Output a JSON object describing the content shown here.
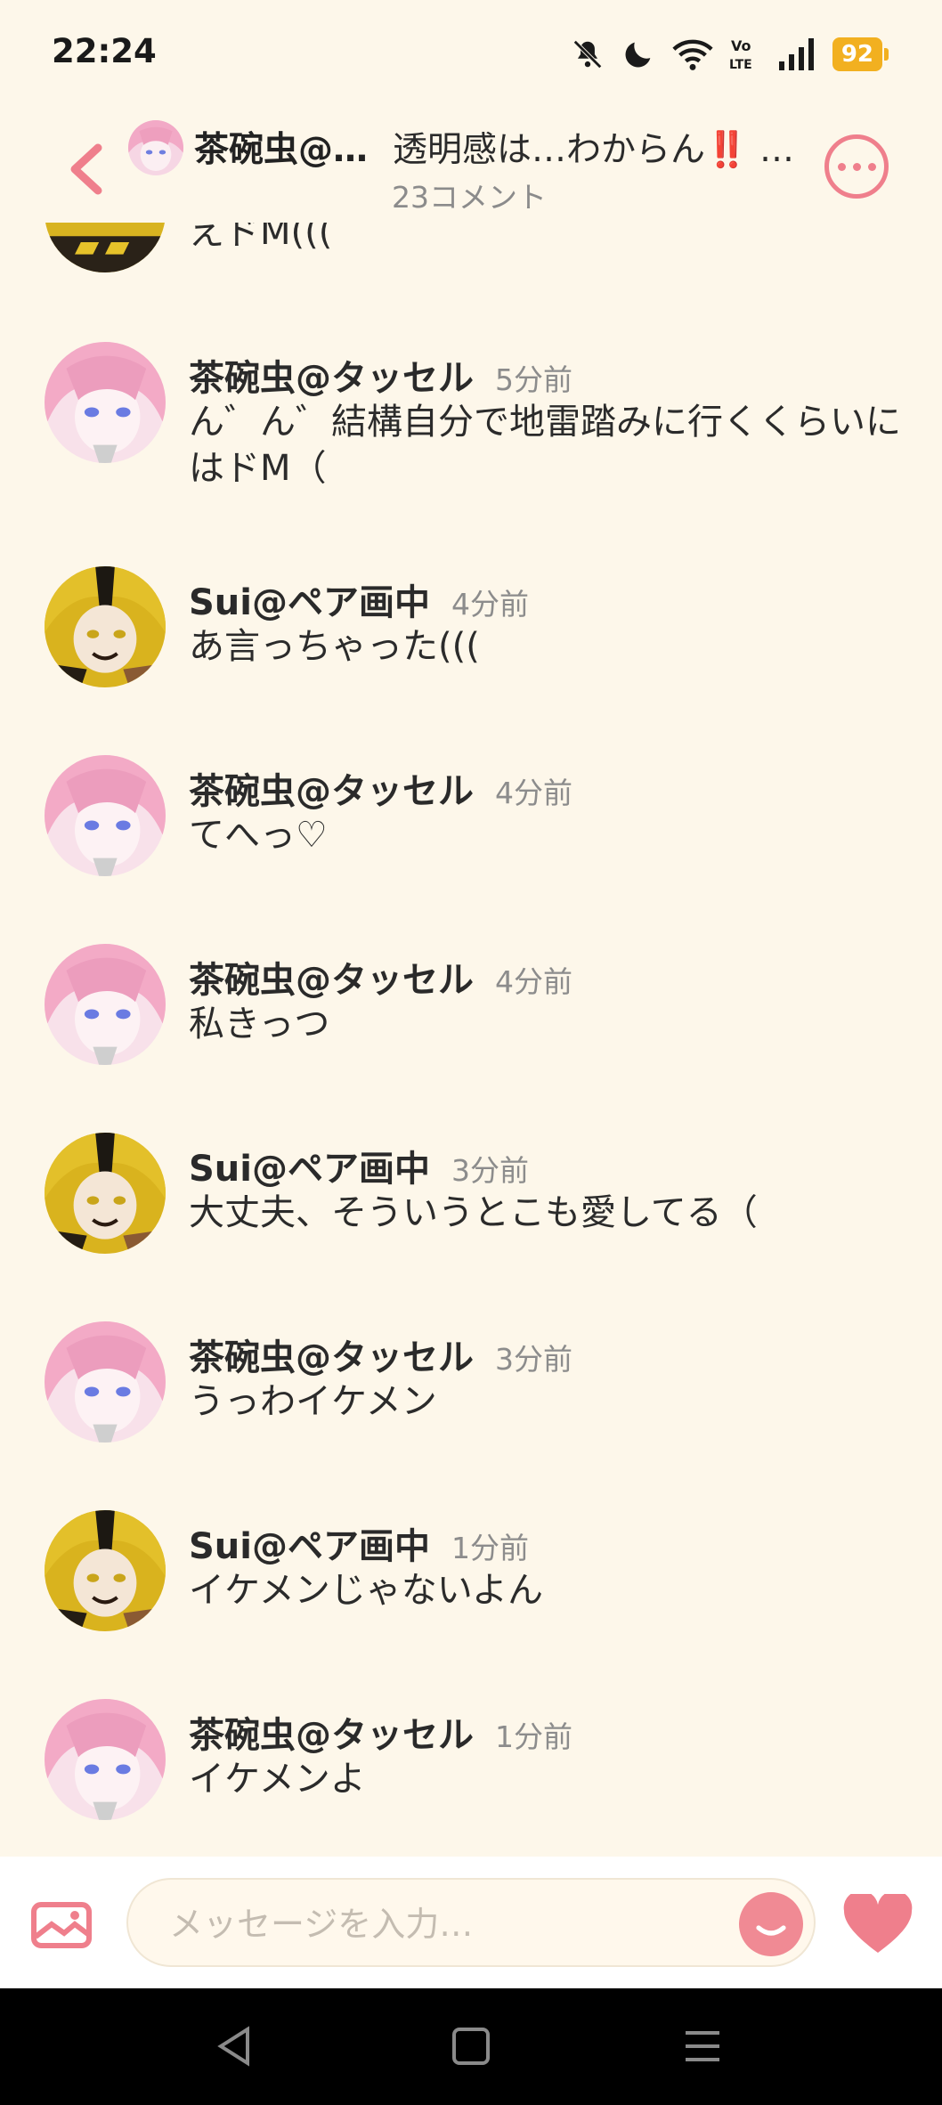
{
  "status_bar": {
    "time": "22:24",
    "battery": "92",
    "icons": [
      "mute-icon",
      "moon-icon",
      "wifi-icon",
      "volte-icon",
      "signal-icon",
      "battery-icon"
    ]
  },
  "header": {
    "user_name": "茶碗虫@…",
    "topic": "透明感は…わからん‼️ …",
    "comment_count": "23コメント",
    "icons": [
      "back-icon",
      "more-icon"
    ]
  },
  "partial_message": {
    "text": "えドM((("
  },
  "messages": [
    {
      "user": "茶碗虫@タッセル",
      "time": "5分前",
      "text": "ん゛ん゛結構自分で地雷踏みに行くくらいにはドM（",
      "avatar": "pink"
    },
    {
      "user": "Sui@ペア画中",
      "time": "4分前",
      "text": "あ言っちゃった(((",
      "avatar": "yellow"
    },
    {
      "user": "茶碗虫@タッセル",
      "time": "4分前",
      "text": "てへっ♡",
      "avatar": "pink"
    },
    {
      "user": "茶碗虫@タッセル",
      "time": "4分前",
      "text": "私きっつ",
      "avatar": "pink"
    },
    {
      "user": "Sui@ペア画中",
      "time": "3分前",
      "text": "大丈夫、そういうとこも愛してる（",
      "avatar": "yellow"
    },
    {
      "user": "茶碗虫@タッセル",
      "time": "3分前",
      "text": "うっわイケメン",
      "avatar": "pink"
    },
    {
      "user": "Sui@ペア画中",
      "time": "1分前",
      "text": "イケメンじゃないよん",
      "avatar": "yellow"
    },
    {
      "user": "茶碗虫@タッセル",
      "time": "1分前",
      "text": "イケメンよ",
      "avatar": "pink"
    }
  ],
  "input": {
    "placeholder": "メッセージを入力…",
    "icons": [
      "image-icon",
      "emoji-icon",
      "heart-icon"
    ]
  },
  "colors": {
    "background": "#fdf7ea",
    "accent": "#ef7f8c",
    "battery": "#f2b020"
  }
}
